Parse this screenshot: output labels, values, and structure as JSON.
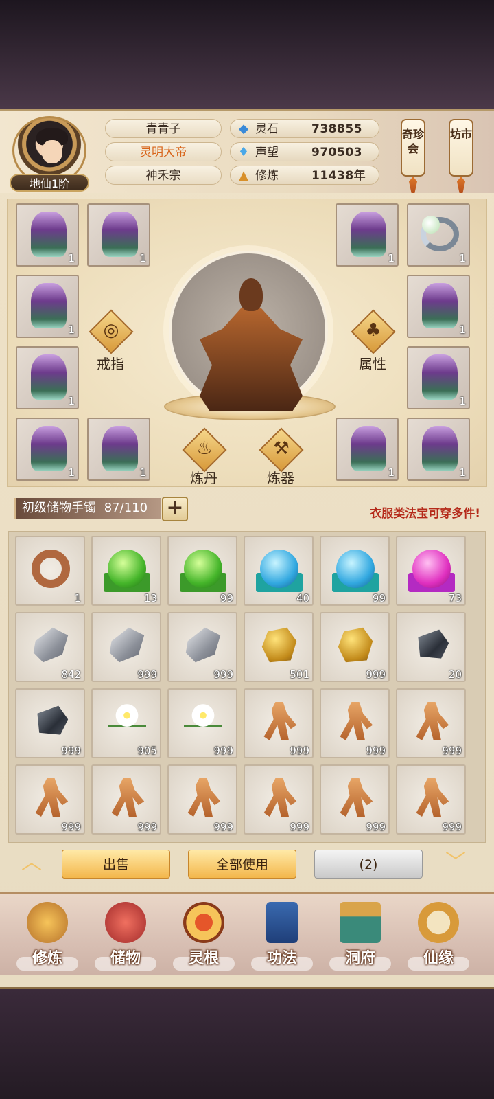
{
  "profile": {
    "name": "青青子",
    "title": "灵明大帝",
    "sect": "神禾宗",
    "rank": "地仙1阶"
  },
  "stats": [
    {
      "icon": "spirit-stone-icon",
      "label": "灵石",
      "value": "738855"
    },
    {
      "icon": "reputation-icon",
      "label": "声望",
      "value": "970503"
    },
    {
      "icon": "cultivation-icon",
      "label": "修炼",
      "value": "11438年"
    }
  ],
  "side_buttons": {
    "treasure": "奇珍会",
    "market": "坊市"
  },
  "equipment": {
    "slots_left": [
      "1",
      "1",
      "1",
      "1",
      "1",
      "1"
    ],
    "slots_right": [
      "1",
      "1",
      "1",
      "1",
      "1",
      "1"
    ],
    "actions": {
      "ring": "戒指",
      "attributes": "属性",
      "alchemy": "炼丹",
      "forging": "炼器"
    }
  },
  "bag": {
    "name": "初级储物手镯",
    "capacity": "87/110",
    "hint": "衣服类法宝可穿多件!",
    "items": [
      {
        "icon": "ring-icon",
        "count": "1"
      },
      {
        "icon": "green-orb-icon",
        "count": "13"
      },
      {
        "icon": "green-orb-icon",
        "count": "99"
      },
      {
        "icon": "cyan-orb-icon",
        "count": "40"
      },
      {
        "icon": "cyan-orb-icon",
        "count": "99"
      },
      {
        "icon": "magenta-orb-icon",
        "count": "73"
      },
      {
        "icon": "silver-stone-icon",
        "count": "842"
      },
      {
        "icon": "silver-stone-icon",
        "count": "999"
      },
      {
        "icon": "silver-stone-icon",
        "count": "999"
      },
      {
        "icon": "gold-ore-icon",
        "count": "501"
      },
      {
        "icon": "gold-ore-icon",
        "count": "999"
      },
      {
        "icon": "dark-ore-icon",
        "count": "20"
      },
      {
        "icon": "dark-ore-icon",
        "count": "999"
      },
      {
        "icon": "white-flower-icon",
        "count": "905"
      },
      {
        "icon": "white-flower-icon",
        "count": "999"
      },
      {
        "icon": "ginseng-icon",
        "count": "999"
      },
      {
        "icon": "ginseng-icon",
        "count": "999"
      },
      {
        "icon": "ginseng-icon",
        "count": "999"
      },
      {
        "icon": "ginseng-icon",
        "count": "999"
      },
      {
        "icon": "ginseng-icon",
        "count": "999"
      },
      {
        "icon": "ginseng-icon",
        "count": "999"
      },
      {
        "icon": "ginseng-icon",
        "count": "999"
      },
      {
        "icon": "ginseng-icon",
        "count": "999"
      },
      {
        "icon": "ginseng-icon",
        "count": "999"
      }
    ]
  },
  "actions": {
    "sell": "出售",
    "use_all": "全部使用",
    "selected": "(2)"
  },
  "nav": [
    "修炼",
    "储物",
    "灵根",
    "功法",
    "洞府",
    "仙缘"
  ],
  "colors": {
    "accent_gold": "#f3b74c",
    "hint_red": "#b52a1a"
  }
}
